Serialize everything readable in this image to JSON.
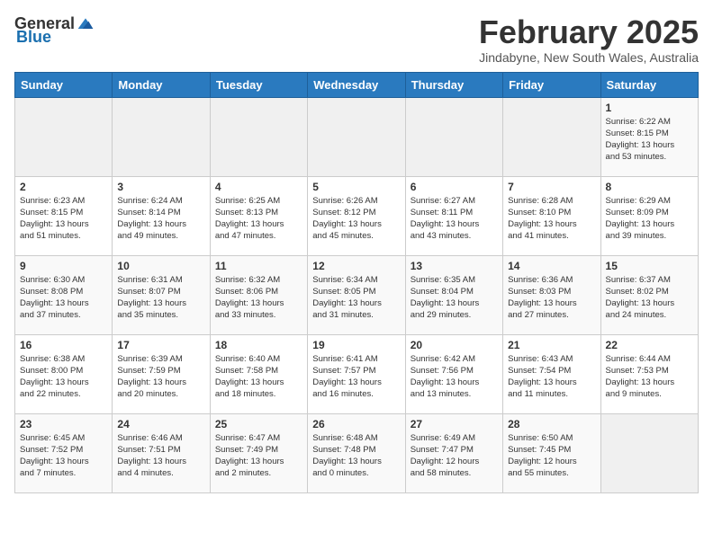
{
  "header": {
    "logo_general": "General",
    "logo_blue": "Blue",
    "month_title": "February 2025",
    "subtitle": "Jindabyne, New South Wales, Australia"
  },
  "weekdays": [
    "Sunday",
    "Monday",
    "Tuesday",
    "Wednesday",
    "Thursday",
    "Friday",
    "Saturday"
  ],
  "weeks": [
    [
      {
        "day": "",
        "info": ""
      },
      {
        "day": "",
        "info": ""
      },
      {
        "day": "",
        "info": ""
      },
      {
        "day": "",
        "info": ""
      },
      {
        "day": "",
        "info": ""
      },
      {
        "day": "",
        "info": ""
      },
      {
        "day": "1",
        "info": "Sunrise: 6:22 AM\nSunset: 8:15 PM\nDaylight: 13 hours\nand 53 minutes."
      }
    ],
    [
      {
        "day": "2",
        "info": "Sunrise: 6:23 AM\nSunset: 8:15 PM\nDaylight: 13 hours\nand 51 minutes."
      },
      {
        "day": "3",
        "info": "Sunrise: 6:24 AM\nSunset: 8:14 PM\nDaylight: 13 hours\nand 49 minutes."
      },
      {
        "day": "4",
        "info": "Sunrise: 6:25 AM\nSunset: 8:13 PM\nDaylight: 13 hours\nand 47 minutes."
      },
      {
        "day": "5",
        "info": "Sunrise: 6:26 AM\nSunset: 8:12 PM\nDaylight: 13 hours\nand 45 minutes."
      },
      {
        "day": "6",
        "info": "Sunrise: 6:27 AM\nSunset: 8:11 PM\nDaylight: 13 hours\nand 43 minutes."
      },
      {
        "day": "7",
        "info": "Sunrise: 6:28 AM\nSunset: 8:10 PM\nDaylight: 13 hours\nand 41 minutes."
      },
      {
        "day": "8",
        "info": "Sunrise: 6:29 AM\nSunset: 8:09 PM\nDaylight: 13 hours\nand 39 minutes."
      }
    ],
    [
      {
        "day": "9",
        "info": "Sunrise: 6:30 AM\nSunset: 8:08 PM\nDaylight: 13 hours\nand 37 minutes."
      },
      {
        "day": "10",
        "info": "Sunrise: 6:31 AM\nSunset: 8:07 PM\nDaylight: 13 hours\nand 35 minutes."
      },
      {
        "day": "11",
        "info": "Sunrise: 6:32 AM\nSunset: 8:06 PM\nDaylight: 13 hours\nand 33 minutes."
      },
      {
        "day": "12",
        "info": "Sunrise: 6:34 AM\nSunset: 8:05 PM\nDaylight: 13 hours\nand 31 minutes."
      },
      {
        "day": "13",
        "info": "Sunrise: 6:35 AM\nSunset: 8:04 PM\nDaylight: 13 hours\nand 29 minutes."
      },
      {
        "day": "14",
        "info": "Sunrise: 6:36 AM\nSunset: 8:03 PM\nDaylight: 13 hours\nand 27 minutes."
      },
      {
        "day": "15",
        "info": "Sunrise: 6:37 AM\nSunset: 8:02 PM\nDaylight: 13 hours\nand 24 minutes."
      }
    ],
    [
      {
        "day": "16",
        "info": "Sunrise: 6:38 AM\nSunset: 8:00 PM\nDaylight: 13 hours\nand 22 minutes."
      },
      {
        "day": "17",
        "info": "Sunrise: 6:39 AM\nSunset: 7:59 PM\nDaylight: 13 hours\nand 20 minutes."
      },
      {
        "day": "18",
        "info": "Sunrise: 6:40 AM\nSunset: 7:58 PM\nDaylight: 13 hours\nand 18 minutes."
      },
      {
        "day": "19",
        "info": "Sunrise: 6:41 AM\nSunset: 7:57 PM\nDaylight: 13 hours\nand 16 minutes."
      },
      {
        "day": "20",
        "info": "Sunrise: 6:42 AM\nSunset: 7:56 PM\nDaylight: 13 hours\nand 13 minutes."
      },
      {
        "day": "21",
        "info": "Sunrise: 6:43 AM\nSunset: 7:54 PM\nDaylight: 13 hours\nand 11 minutes."
      },
      {
        "day": "22",
        "info": "Sunrise: 6:44 AM\nSunset: 7:53 PM\nDaylight: 13 hours\nand 9 minutes."
      }
    ],
    [
      {
        "day": "23",
        "info": "Sunrise: 6:45 AM\nSunset: 7:52 PM\nDaylight: 13 hours\nand 7 minutes."
      },
      {
        "day": "24",
        "info": "Sunrise: 6:46 AM\nSunset: 7:51 PM\nDaylight: 13 hours\nand 4 minutes."
      },
      {
        "day": "25",
        "info": "Sunrise: 6:47 AM\nSunset: 7:49 PM\nDaylight: 13 hours\nand 2 minutes."
      },
      {
        "day": "26",
        "info": "Sunrise: 6:48 AM\nSunset: 7:48 PM\nDaylight: 13 hours\nand 0 minutes."
      },
      {
        "day": "27",
        "info": "Sunrise: 6:49 AM\nSunset: 7:47 PM\nDaylight: 12 hours\nand 58 minutes."
      },
      {
        "day": "28",
        "info": "Sunrise: 6:50 AM\nSunset: 7:45 PM\nDaylight: 12 hours\nand 55 minutes."
      },
      {
        "day": "",
        "info": ""
      }
    ]
  ]
}
